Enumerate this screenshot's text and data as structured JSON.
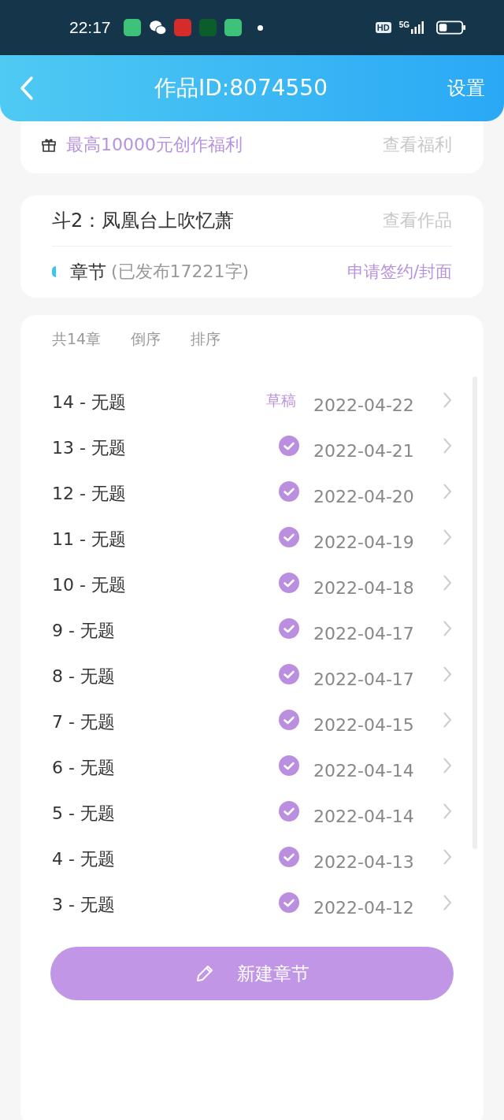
{
  "status_bar": {
    "time": "22:17",
    "hd": "HD",
    "network": "5G"
  },
  "header": {
    "title": "作品ID:8074550",
    "action": "设置"
  },
  "promo": {
    "text": "最高10000元创作福利",
    "link": "查看福利"
  },
  "work": {
    "title": "斗2：凤凰台上吹忆萧",
    "view": "查看作品",
    "section": "章节",
    "published": "(已发布17221字)",
    "apply": "申请签约/封面"
  },
  "toolbar": [
    "共14章",
    "倒序",
    "排序"
  ],
  "chapters": [
    {
      "title": "14 - 无题",
      "kind": "draft",
      "badge": "草稿",
      "date": "2022-04-22"
    },
    {
      "title": "13 - 无题",
      "kind": "published",
      "date": "2022-04-21"
    },
    {
      "title": "12 - 无题",
      "kind": "published",
      "date": "2022-04-20"
    },
    {
      "title": "11 - 无题",
      "kind": "published",
      "date": "2022-04-19"
    },
    {
      "title": "10 - 无题",
      "kind": "published",
      "date": "2022-04-18"
    },
    {
      "title": "9 - 无题",
      "kind": "published",
      "date": "2022-04-17"
    },
    {
      "title": "8 - 无题",
      "kind": "published",
      "date": "2022-04-17"
    },
    {
      "title": "7 - 无题",
      "kind": "published",
      "date": "2022-04-15"
    },
    {
      "title": "6 - 无题",
      "kind": "published",
      "date": "2022-04-14"
    },
    {
      "title": "5 - 无题",
      "kind": "published",
      "date": "2022-04-14"
    },
    {
      "title": "4 - 无题",
      "kind": "published",
      "date": "2022-04-13"
    },
    {
      "title": "3 - 无题",
      "kind": "published",
      "date": "2022-04-12"
    }
  ],
  "new_button": "新建章节"
}
